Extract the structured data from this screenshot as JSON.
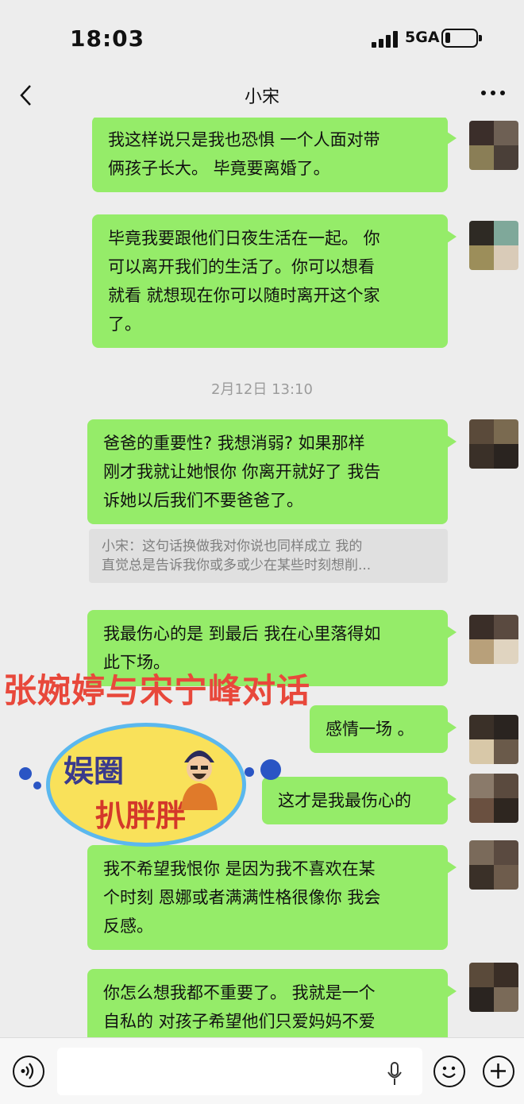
{
  "status_bar": {
    "time": "18:03",
    "network": "5GA",
    "battery_level": 0.15
  },
  "nav": {
    "title": "小宋",
    "back_icon": "chevron-left-icon",
    "more_icon": "more-dots-icon"
  },
  "messages": [
    {
      "lines": [
        "我这样说只是我也恐惧 一个人面对带",
        "俩孩子长大。 毕竟要离婚了。"
      ]
    },
    {
      "lines": [
        "毕竟我要跟他们日夜生活在一起。 你",
        "可以离开我们的生活了。你可以想看",
        "就看 就想现在你可以随时离开这个家",
        "了。"
      ]
    },
    {
      "lines": [
        "爸爸的重要性? 我想消弱? 如果那样",
        "刚才我就让她恨你 你离开就好了 我告",
        "诉她以后我们不要爸爸了。"
      ]
    },
    {
      "lines": [
        "我最伤心的是 到最后 我在心里落得如",
        "此下场。"
      ]
    },
    {
      "lines": [
        "感情一场 。"
      ]
    },
    {
      "lines": [
        "这才是我最伤心的"
      ]
    },
    {
      "lines": [
        "我不希望我恨你 是因为我不喜欢在某",
        "个时刻 恩娜或者满满性格很像你 我会",
        "反感。"
      ]
    },
    {
      "lines": [
        "你怎么想我都不重要了。 我就是一个",
        "自私的 对孩子希望他们只爱妈妈不爱"
      ]
    }
  ],
  "timestamp": "2月12日 13:10",
  "quote": {
    "lines": [
      "小宋：这句话换做我对你说也同样成立 我的",
      "直觉总是告诉我你或多或少在某些时刻想削..."
    ]
  },
  "watermark": {
    "text": "张婉婷与宋宁峰对话"
  },
  "logo": {
    "line1": "娱圈",
    "line2": "扒胖胖"
  },
  "input_bar": {
    "voice_icon": "voice-icon",
    "mic_icon": "microphone-icon",
    "emoji_icon": "emoji-icon",
    "plus_icon": "plus-icon",
    "value": ""
  },
  "colors": {
    "bubble": "#95ec69",
    "background": "#ededed",
    "watermark": "#e8483b"
  }
}
